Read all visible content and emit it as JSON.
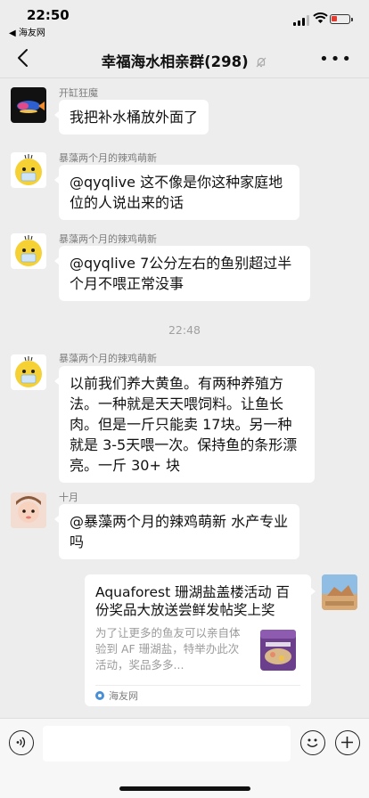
{
  "status_bar": {
    "time": "22:50",
    "back_app": "◀ 海友网"
  },
  "nav": {
    "title": "幸福海水相亲群(298)"
  },
  "messages": [
    {
      "sender": "开缸狂魔",
      "text": "我把补水桶放外面了"
    },
    {
      "sender": "暴藻两个月的辣鸡萌新",
      "text": "@qyqlive 这不像是你这种家庭地位的人说出来的话"
    },
    {
      "sender": "暴藻两个月的辣鸡萌新",
      "text": "@qyqlive 7公分左右的鱼别超过半个月不喂正常没事"
    },
    {
      "sender": "暴藻两个月的辣鸡萌新",
      "text": "以前我们养大黄鱼。有两种养殖方法。一种就是天天喂饲料。让鱼长肉。但是一斤只能卖 17块。另一种就是 3-5天喂一次。保持鱼的条形漂亮。一斤 30+ 块"
    },
    {
      "sender": "十月",
      "text": "@暴藻两个月的辣鸡萌新 水产专业吗"
    }
  ],
  "timestamp": "22:48",
  "share_card": {
    "title": "Aquaforest 珊湖盐盖楼活动 百份奖品大放送尝鲜发帖奖上奖",
    "body": "为了让更多的鱼友可以亲自体验到 AF 珊湖盐，特举办此次活动，奖品多多...",
    "source": "海友网"
  },
  "colors": {
    "background": "#ededed",
    "bubble": "#ffffff",
    "card_link": "#4a8fd6"
  },
  "icons": [
    "chevron-left-icon",
    "mute-bell-icon",
    "more-dots-icon",
    "voice-icon",
    "emoji-icon",
    "plus-icon"
  ]
}
